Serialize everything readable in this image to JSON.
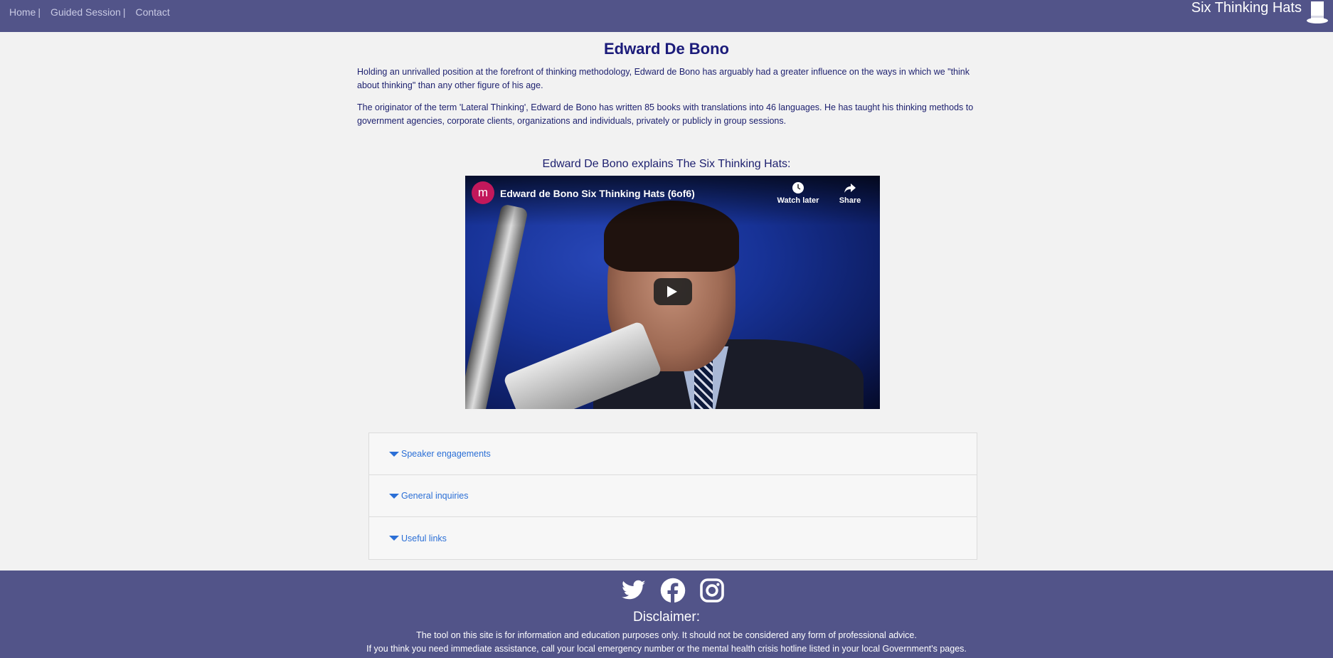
{
  "nav": {
    "links": [
      "Home",
      "Guided Session",
      "Contact"
    ],
    "separator": "|",
    "brand": "Six Thinking Hats"
  },
  "main": {
    "title": "Edward De Bono",
    "paragraphs": [
      "Holding an unrivalled position at the forefront of thinking methodology, Edward de Bono has arguably had a greater influence on the ways in which we \"think about thinking\" than any other figure of his age.",
      "The originator of the term 'Lateral Thinking', Edward de Bono has written 85 books with translations into 46 languages. He has taught his thinking methods to government agencies, corporate clients, organizations and individuals, privately or publicly in group sessions."
    ],
    "video_caption": "Edward De Bono explains The Six Thinking Hats:"
  },
  "video": {
    "channel_initial": "m",
    "title": "Edward de Bono Six Thinking Hats (6of6)",
    "watch_later": "Watch later",
    "share": "Share"
  },
  "accordion": {
    "items": [
      "Speaker engagements",
      "General inquiries",
      "Useful links"
    ]
  },
  "footer": {
    "disclaimer_title": "Disclaimer:",
    "lines": [
      "The tool on this site is for information and education purposes only. It should not be considered any form of professional advice.",
      "If you think you need immediate assistance, call your local emergency number or the mental health crisis hotline listed in your local Government's pages."
    ]
  },
  "colors": {
    "header_bg": "#525489",
    "page_bg": "#f2f2f2",
    "text": "#1c1f6e",
    "link": "#2b6fd6"
  }
}
